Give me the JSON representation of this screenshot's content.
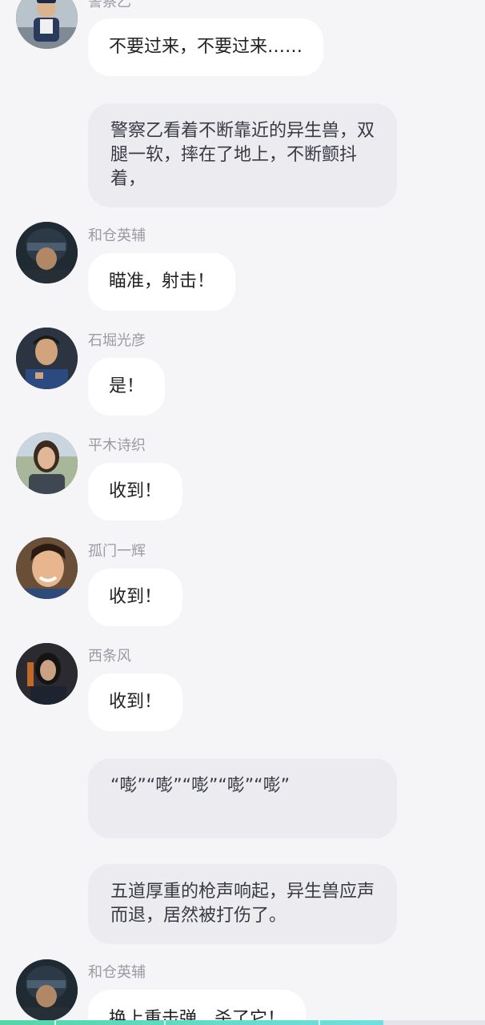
{
  "messages": [
    {
      "type": "chat",
      "speaker": "警察乙",
      "text": "不要过来，不要过来……",
      "avatar_icon": "police-officer-avatar"
    },
    {
      "type": "narration",
      "text": "警察乙看着不断靠近的异生兽，双腿一软，摔在了地上，不断颤抖着，"
    },
    {
      "type": "chat",
      "speaker": "和仓英辅",
      "text": "瞄准，射击！",
      "avatar_icon": "helmeted-commander-avatar"
    },
    {
      "type": "chat",
      "speaker": "石堀光彦",
      "text": "是！",
      "avatar_icon": "uniformed-man-avatar"
    },
    {
      "type": "chat",
      "speaker": "平木诗织",
      "text": "收到！",
      "avatar_icon": "woman-avatar"
    },
    {
      "type": "chat",
      "speaker": "孤门一辉",
      "text": "收到！",
      "avatar_icon": "smiling-man-avatar"
    },
    {
      "type": "chat",
      "speaker": "西条风",
      "text": "收到！",
      "avatar_icon": "dark-haired-woman-avatar"
    },
    {
      "type": "narration",
      "text": "“嘭”“嘭”“嘭”“嘭”“嘭”"
    },
    {
      "type": "narration",
      "text": "五道厚重的枪声响起，异生兽应声而退，居然被打伤了。"
    },
    {
      "type": "chat",
      "speaker": "和仓英辅",
      "text": "换上重击弹，杀了它！",
      "avatar_icon": "helmeted-commander-avatar"
    }
  ],
  "progress": {
    "value": 0.79
  },
  "colors": {
    "background": "#f5f5f8",
    "chat_bubble": "#ffffff",
    "narration_bubble": "#ebebf0",
    "name_text": "#9a9aa2",
    "progress_accent": "#53d6a8"
  }
}
